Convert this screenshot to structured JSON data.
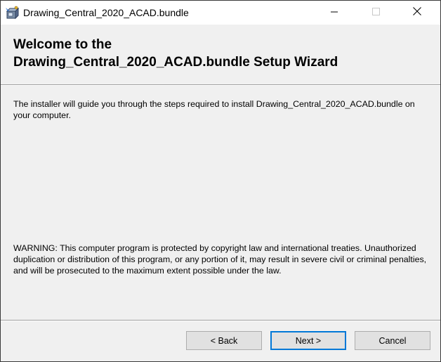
{
  "window": {
    "title": "Drawing_Central_2020_ACAD.bundle",
    "icon": "installer-package-icon",
    "controls": {
      "minimize": "minimize-icon",
      "maximize": "maximize-icon",
      "close": "close-icon"
    }
  },
  "header": {
    "title_line1": "Welcome to the",
    "title_line2": "Drawing_Central_2020_ACAD.bundle Setup Wizard"
  },
  "body": {
    "intro": "The installer will guide you through the steps required to install Drawing_Central_2020_ACAD.bundle on your computer.",
    "warning": "WARNING: This computer program is protected by copyright law and international treaties. Unauthorized duplication or distribution of this program, or any portion of it, may result in severe civil or criminal penalties, and will be prosecuted to the maximum extent possible under the law."
  },
  "buttons": {
    "back": "< Back",
    "next": "Next >",
    "cancel": "Cancel"
  },
  "colors": {
    "default_button_border": "#0078d7",
    "window_background": "#f0f0f0",
    "titlebar_background": "#ffffff"
  }
}
